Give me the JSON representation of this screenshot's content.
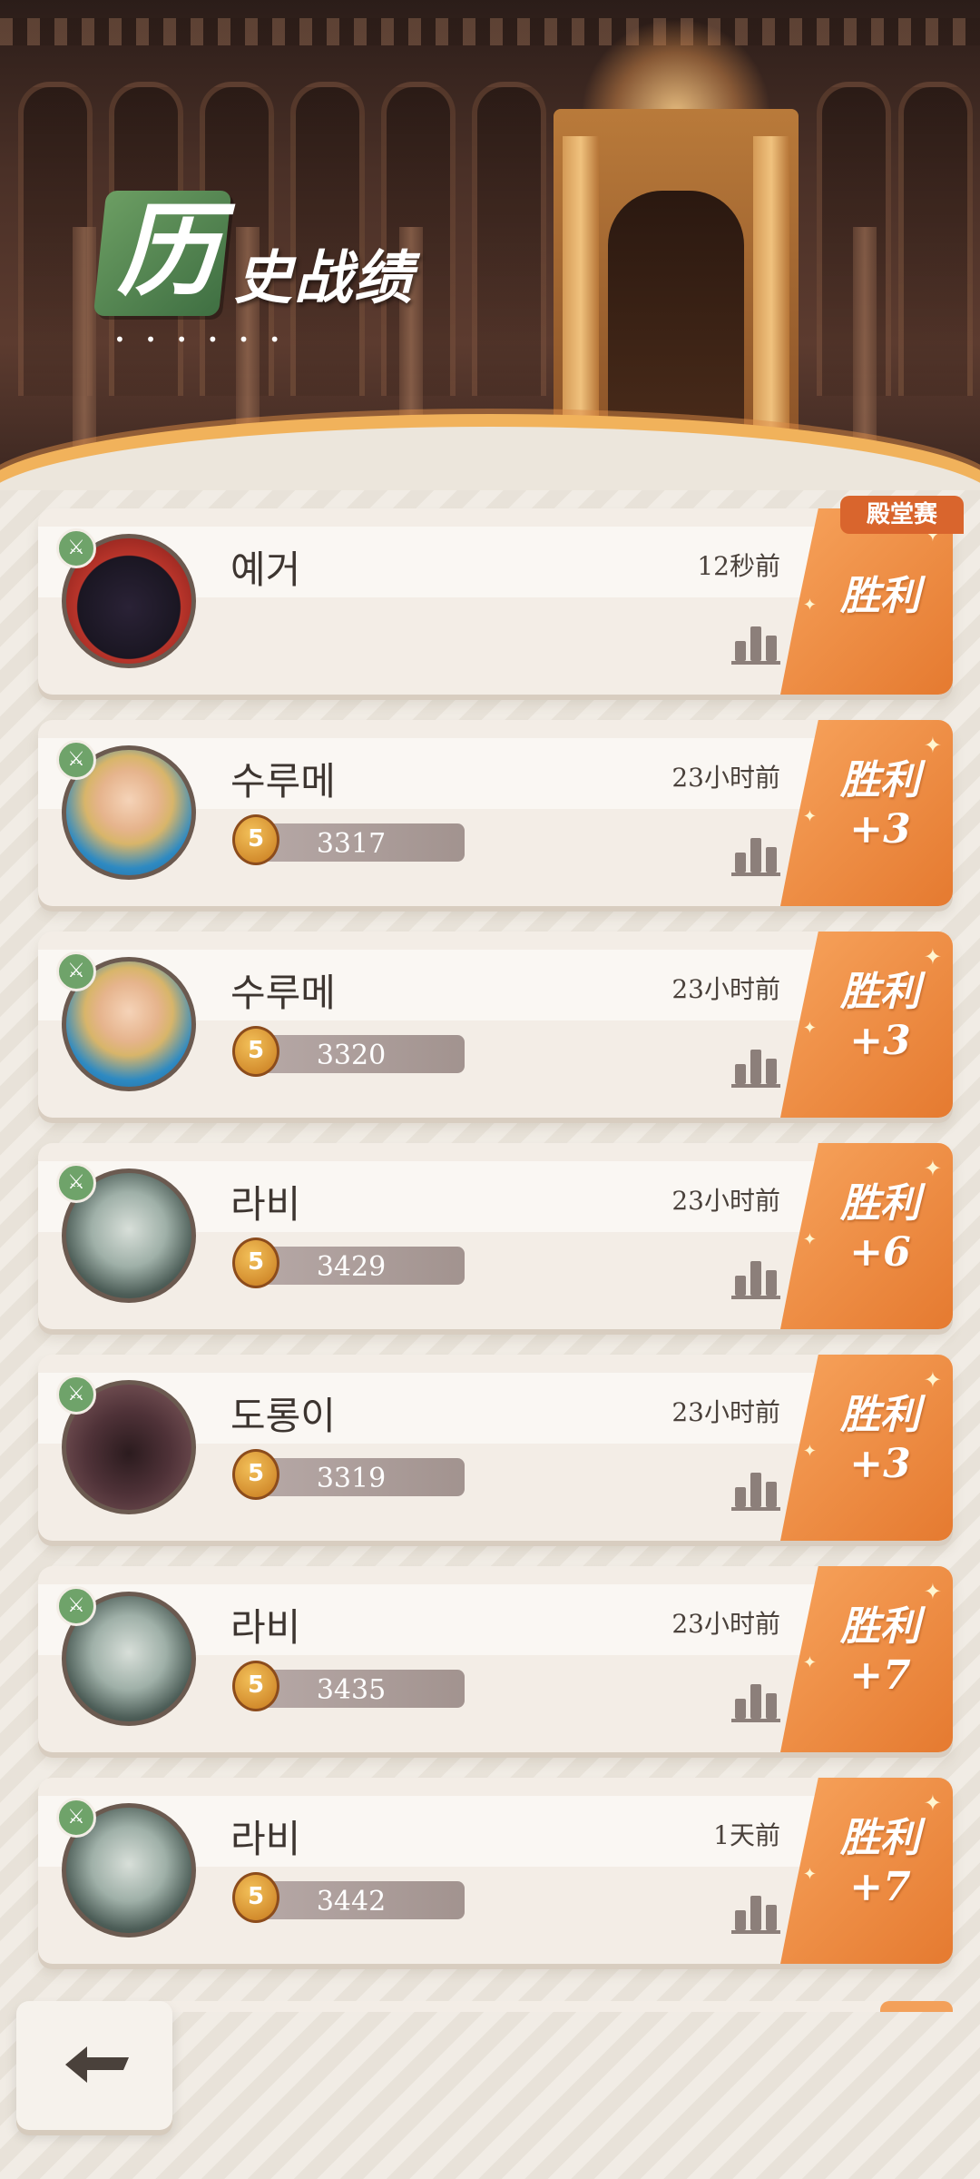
{
  "header": {
    "title_first_char": "历",
    "title_rest": "史战绩",
    "dots": "• • • • • •"
  },
  "matches": [
    {
      "name": "예거",
      "time": "12秒前",
      "score": "",
      "result": "胜利",
      "delta": "",
      "tag": "殿堂赛",
      "avatar": "cat-masked-hero"
    },
    {
      "name": "수루메",
      "time": "23小时前",
      "score": "3317",
      "result": "胜利",
      "delta": "+3",
      "tag": "",
      "avatar": "elf-hero"
    },
    {
      "name": "수루메",
      "time": "23小时前",
      "score": "3320",
      "result": "胜利",
      "delta": "+3",
      "tag": "",
      "avatar": "elf-hero"
    },
    {
      "name": "라비",
      "time": "23小时前",
      "score": "3429",
      "result": "胜利",
      "delta": "+6",
      "tag": "",
      "avatar": "ghost-knight-hero"
    },
    {
      "name": "도롱이",
      "time": "23小时前",
      "score": "3319",
      "result": "胜利",
      "delta": "+3",
      "tag": "",
      "avatar": "hooded-hero"
    },
    {
      "name": "라비",
      "time": "23小时前",
      "score": "3435",
      "result": "胜利",
      "delta": "+7",
      "tag": "",
      "avatar": "ghost-knight-hero"
    },
    {
      "name": "라비",
      "time": "1天前",
      "score": "3442",
      "result": "胜利",
      "delta": "+7",
      "tag": "",
      "avatar": "ghost-knight-hero"
    }
  ],
  "rank_icon_label": "5",
  "colors": {
    "accent_orange": "#e57a30",
    "badge_green": "#6fa36a",
    "hall_tag": "#d9652d"
  }
}
